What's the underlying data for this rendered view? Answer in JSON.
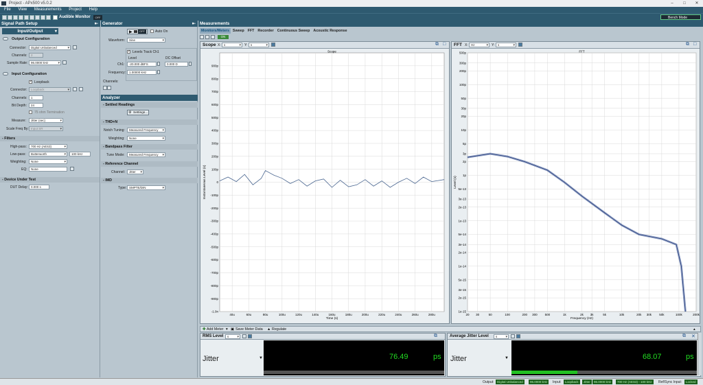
{
  "window": {
    "title": "Project - APx500 v5.0.2"
  },
  "menu": [
    "File",
    "View",
    "Measurements",
    "Project",
    "Help"
  ],
  "toolbar": {
    "audible_monitor": "Audible Monitor",
    "off": "OFF",
    "bench_mode": "Bench Mode"
  },
  "signal_path": {
    "header": "Signal Path Setup",
    "selector": "Input/Output",
    "output_config": {
      "title": "Output Configuration",
      "connector_label": "Connector:",
      "connector_value": "Digital Unbalanced",
      "channels_label": "Channels:",
      "channels_value": "2",
      "sample_rate_label": "Sample Rate:",
      "sample_rate_value": "96.0000 kHz"
    },
    "input_config": {
      "title": "Input Configuration",
      "loopback_label": "Loopback",
      "connector_label": "Connector:",
      "connector_value": "Loopback",
      "channels_label": "Channels:",
      "channels_value": "1",
      "bit_depth_label": "Bit Depth:",
      "bit_depth_value": "24",
      "termination_label": "75 ohm Termination",
      "measure_label": "Measure:",
      "measure_value": "Jitter (sec)",
      "scale_label": "Scale Freq By:",
      "scale_value": "Input SR"
    },
    "filters": {
      "title": "Filters",
      "highpass_label": "High-pass:",
      "highpass_value": "700 Hz (AES3)",
      "lowpass_label": "Low-pass:",
      "lowpass_value": "Butterworth",
      "lowpass_freq": "100 kHz",
      "weighting_label": "Weighting:",
      "weighting_value": "None",
      "eq_label": "EQ:",
      "eq_value": "None"
    },
    "dut": {
      "title": "Device Under Test",
      "delay_label": "DUT Delay:",
      "delay_value": "0.000 s"
    }
  },
  "generator": {
    "header": "Generator",
    "off": "OFF",
    "auto_on": "Auto On",
    "waveform_label": "Waveform:",
    "waveform_value": "Sine",
    "levels_track": "Levels Track Ch1",
    "level_col": "Level",
    "dc_col": "DC Offset",
    "ch1_label": "Ch1:",
    "ch1_level": "-20.000 dBFS",
    "ch1_dc": "0.000 D",
    "freq_label": "Frequency:",
    "freq_value": "1.00000 kHz",
    "channels_label": "Channels:"
  },
  "analyzer": {
    "header": "Analyzer",
    "settled_title": "Settled Readings",
    "settings_btn": "Settings...",
    "thdn_title": "THD+N",
    "notch_label": "Notch Tuning:",
    "notch_value": "Measured Frequency",
    "weight_label": "Weighting:",
    "weight_value": "None",
    "bandpass_title": "Bandpass Filter",
    "tune_label": "Tune Mode:",
    "tune_value": "Measured Frequency",
    "ref_title": "Reference Channel",
    "ref_label": "Channel:",
    "ref_value": "Jitter",
    "imd_title": "IMD",
    "type_label": "Type:",
    "type_value": "SMPTE/DIN"
  },
  "measurements": {
    "header": "Measurements",
    "tabs": [
      "Monitors/Meters",
      "Sweep",
      "FFT",
      "Recorder",
      "Continuous Sweep",
      "Acoustic Response"
    ],
    "on_label": "ON"
  },
  "scope": {
    "title": "Scope",
    "x_label": "X:",
    "x_unit": "s",
    "y_label": "Y:",
    "y_unit": "s",
    "chart_title": "Scope",
    "ylabel": "Instantaneous Level (s)",
    "xlabel": "Time (s)"
  },
  "fft": {
    "title": "FFT",
    "x_label": "X:",
    "x_unit": "Hz",
    "y_label": "Y:",
    "y_unit": "s",
    "chart_title": "FFT",
    "ylabel": "Level (s)",
    "xlabel": "Frequency (Hz)"
  },
  "chart_data": [
    {
      "type": "line",
      "title": "Scope",
      "xlabel": "Time (s)",
      "ylabel": "Instantaneous Level (s)",
      "x_ticks": [
        "40u",
        "60u",
        "80u",
        "100u",
        "120u",
        "140u",
        "160u",
        "180u",
        "200u",
        "220u",
        "240u",
        "260u",
        "280u"
      ],
      "y_ticks": [
        "900p",
        "800p",
        "700p",
        "600p",
        "500p",
        "400p",
        "300p",
        "200p",
        "100p",
        "0",
        "-100p",
        "-200p",
        "-300p",
        "-400p",
        "-500p",
        "-600p",
        "-700p",
        "-800p",
        "-900p",
        "-1.0n"
      ],
      "xlim_us": [
        25,
        295
      ],
      "ylim_ps": [
        -1000,
        1000
      ],
      "series": [
        {
          "x_us": [
            25,
            35,
            45,
            55,
            65,
            75,
            80,
            90,
            100,
            110,
            120,
            130,
            140,
            150,
            160,
            170,
            180,
            190,
            200,
            210,
            220,
            230,
            240,
            250,
            260,
            270,
            280,
            295
          ],
          "y_ps": [
            10,
            40,
            5,
            60,
            -20,
            30,
            90,
            55,
            30,
            -10,
            20,
            -30,
            10,
            25,
            -40,
            15,
            -35,
            -20,
            20,
            -30,
            10,
            -40,
            0,
            30,
            -10,
            40,
            5,
            20
          ]
        }
      ],
      "grid": true
    },
    {
      "type": "line",
      "title": "FFT",
      "xlabel": "Frequency (Hz)",
      "ylabel": "Level (s)",
      "x_scale": "log",
      "x_ticks": [
        "20",
        "30",
        "50",
        "100",
        "200",
        "300",
        "500",
        "1k",
        "2k",
        "3k",
        "5k",
        "10k",
        "20k",
        "30k",
        "50k",
        "100k",
        "200k"
      ],
      "y_ticks": [
        "500p",
        "300p",
        "200p",
        "100p",
        "50p",
        "30p",
        "20p",
        "10p",
        "5p",
        "3p",
        "2p",
        "1p",
        "5e-13",
        "3e-13",
        "2e-13",
        "1e-13",
        "5e-14",
        "3e-14",
        "2e-14",
        "1e-14",
        "5e-15",
        "3e-15",
        "2e-15",
        "1e-15"
      ],
      "xlim_hz": [
        20,
        200000
      ],
      "ylim_s": [
        1e-15,
        5e-10
      ],
      "series": [
        {
          "x_hz": [
            20,
            50,
            100,
            200,
            500,
            1000,
            2000,
            5000,
            10000,
            20000,
            50000,
            90000,
            110000,
            130000
          ],
          "y_s": [
            2.5e-12,
            3e-12,
            2.6e-12,
            2e-12,
            1.3e-12,
            7e-13,
            3.5e-13,
            1.5e-13,
            8e-14,
            5e-14,
            4e-14,
            3e-14,
            1e-14,
            1e-15
          ]
        }
      ],
      "grid": true
    }
  ],
  "meters": [
    {
      "title": "RMS Level",
      "unit_select": "s",
      "label": "Jitter",
      "value": "76.49",
      "unit": "ps"
    },
    {
      "title": "Average Jitter Level",
      "unit_select": "s",
      "label": "Jitter",
      "value": "68.07",
      "unit": "ps"
    }
  ],
  "meter_toolbar": {
    "add_meter": "Add Meter",
    "save_meter": "Save Meter Data",
    "regulate": "Regulate"
  },
  "status": {
    "output_label": "Output:",
    "output_conn": "Digital Unbalanced",
    "output_sr": "96.0000 kHz",
    "input_label": "Input:",
    "input_conn": "Loopback",
    "input_measure": "Jitter",
    "input_sr": "96.0000 kHz",
    "input_filter": "700 Hz (AES3) - 100 kHz",
    "ref_label": "Ref/Sync Input:",
    "ref_value": "Locked"
  }
}
